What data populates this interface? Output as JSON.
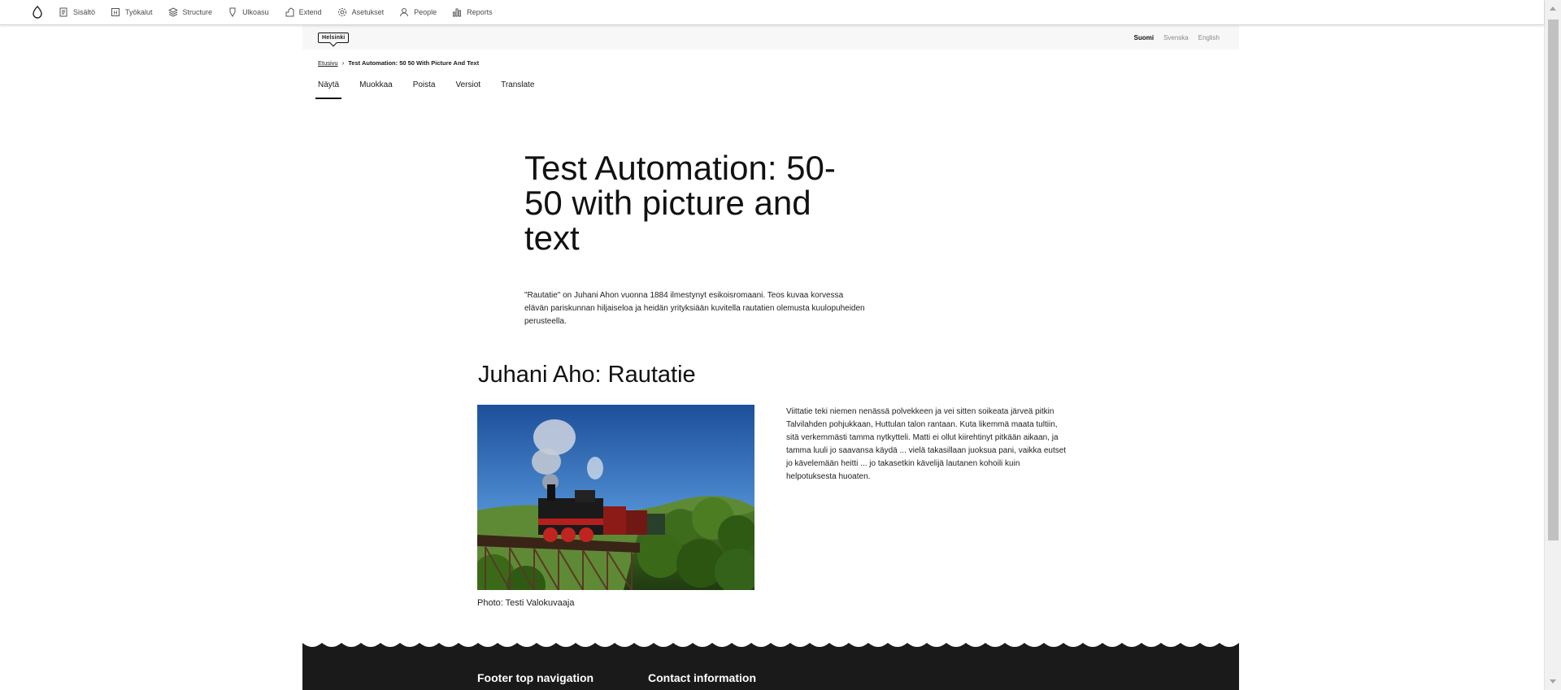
{
  "toolbar": {
    "items": [
      {
        "label": "Sisältö",
        "icon": "content-icon"
      },
      {
        "label": "Työkalut",
        "icon": "tools-icon"
      },
      {
        "label": "Structure",
        "icon": "structure-icon"
      },
      {
        "label": "Ulkoasu",
        "icon": "appearance-icon"
      },
      {
        "label": "Extend",
        "icon": "extend-icon"
      },
      {
        "label": "Asetukset",
        "icon": "gear-icon"
      },
      {
        "label": "People",
        "icon": "person-icon"
      },
      {
        "label": "Reports",
        "icon": "reports-icon"
      }
    ]
  },
  "header": {
    "logo": "Helsinki",
    "languages": [
      {
        "label": "Suomi",
        "active": true
      },
      {
        "label": "Svenska",
        "active": false
      },
      {
        "label": "English",
        "active": false
      }
    ]
  },
  "breadcrumb": {
    "home": "Etusivu",
    "current": "Test Automation: 50 50 With Picture And Text"
  },
  "tabs": [
    {
      "label": "Näytä",
      "active": true
    },
    {
      "label": "Muokkaa",
      "active": false
    },
    {
      "label": "Poista",
      "active": false
    },
    {
      "label": "Versiot",
      "active": false
    },
    {
      "label": "Translate",
      "active": false
    }
  ],
  "page": {
    "title": "Test Automation: 50-50 with picture and text",
    "lead": "\"Rautatie\" on Juhani Ahon vuonna 1884 ilmestynyt esikoisromaani. Teos kuvaa korvessa elävän pariskunnan hiljaiseloa ja heidän yrityksiään kuvitella rautatien olemusta kuulopuheiden perusteella.",
    "section_title": "Juhani Aho: Rautatie",
    "photo_caption": "Photo: Testi Valokuvaaja",
    "body": " Viittatie teki niemen nenässä polvekkeen ja vei sitten soikeata järveä pitkin Talvilahden pohjukkaan, Huttulan talon rantaan. Kuta likemmä maata tultiin, sitä verkemmästi tamma nytkytteli. Matti ei ollut kiirehtinyt pitkään aikaan, ja tamma luuli jo saavansa käydä ... vielä takasillaan juoksua pani, vaikka eutset jo kävelemään heitti ... jo takasetkin kävelijä lautanen kohoili kuin helpotuksesta huoaten."
  },
  "footer": {
    "nav_title": "Footer top navigation",
    "contact_title": "Contact information"
  }
}
